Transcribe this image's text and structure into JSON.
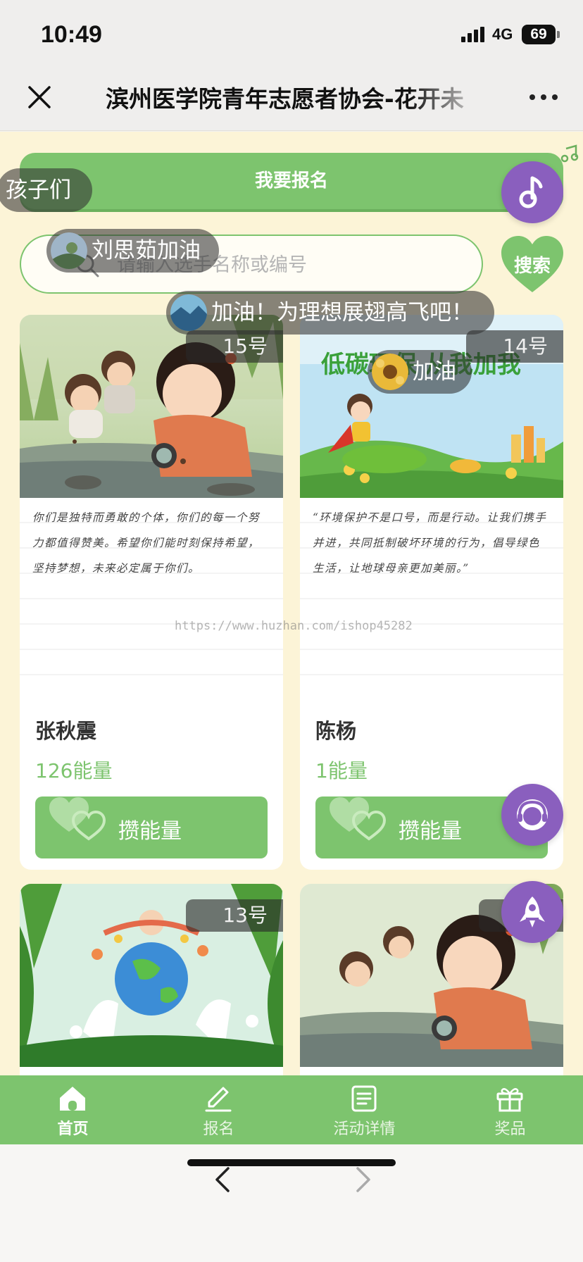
{
  "status": {
    "time": "10:49",
    "network": "4G",
    "battery": "69"
  },
  "navbar": {
    "title": "滨州医学院青年志愿者协会-花开未"
  },
  "signup": {
    "label": "我要报名"
  },
  "search": {
    "placeholder": "请输入选手名称或编号",
    "button": "搜索"
  },
  "danmaku": [
    {
      "text": "孩子们"
    },
    {
      "text": "刘思茹加油"
    },
    {
      "text": "加油！为理想展翅高飞吧！"
    },
    {
      "text": "加油"
    }
  ],
  "cards": [
    {
      "number": "15号",
      "note": "你们是独特而勇敢的个体，你们的每一个努力都值得赞美。希望你们能时刻保持希望，坚持梦想，未来必定属于你们。",
      "name": "张秋震",
      "energy": "126能量",
      "vote_label": "攒能量"
    },
    {
      "number": "14号",
      "note": "“环境保护不是口号，而是行动。让我们携手并进，共同抵制破坏环境的行为，倡导绿色生活，让地球母亲更加美丽。”",
      "name": "陈杨",
      "energy": "1能量",
      "vote_label": "攒能量",
      "poster_title": "低碳环保 从我加我"
    },
    {
      "number": "13号"
    },
    {
      "number": "6号"
    }
  ],
  "watermark": "https://www.huzhan.com/ishop45282",
  "tabs": [
    {
      "label": "首页",
      "icon": "home-icon",
      "active": true
    },
    {
      "label": "报名",
      "icon": "pencil-icon",
      "active": false
    },
    {
      "label": "活动详情",
      "icon": "document-icon",
      "active": false
    },
    {
      "label": "奖品",
      "icon": "gift-icon",
      "active": false
    }
  ],
  "colors": {
    "primary_green": "#7dc46e",
    "background": "#fcf4d7",
    "fab_purple": "#8a5fbe"
  }
}
